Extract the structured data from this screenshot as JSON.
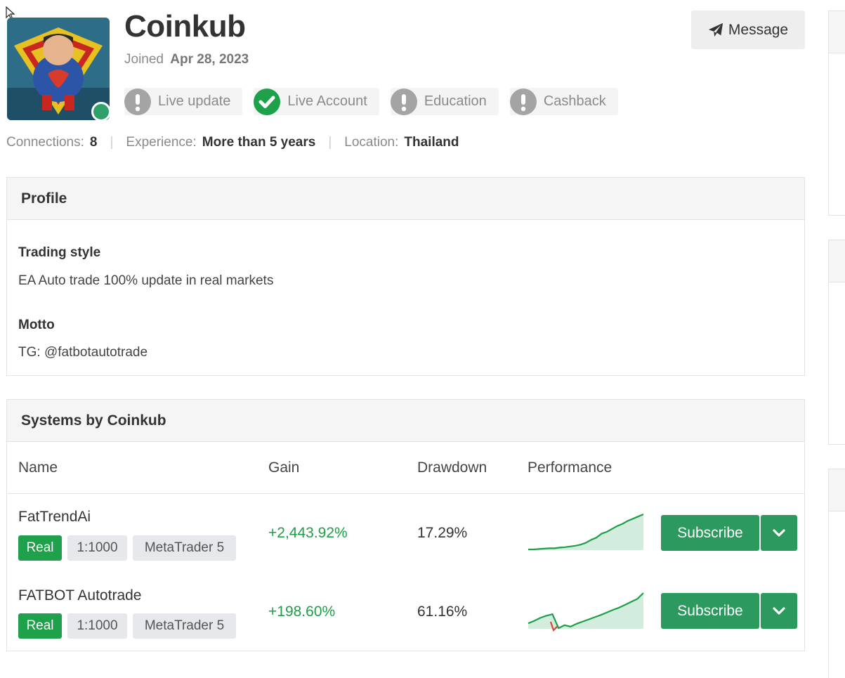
{
  "profile_header": {
    "name": "Coinkub",
    "joined_label": "Joined",
    "joined_date": "Apr 28, 2023",
    "message_label": "Message",
    "online_color": "#2ea06a"
  },
  "badges": [
    {
      "label": "Live update",
      "status": "warning",
      "icon": "exclamation-icon"
    },
    {
      "label": "Live Account",
      "status": "verified",
      "icon": "check-icon"
    },
    {
      "label": "Education",
      "status": "warning",
      "icon": "exclamation-icon"
    },
    {
      "label": "Cashback",
      "status": "warning",
      "icon": "exclamation-icon"
    }
  ],
  "stats": {
    "connections_label": "Connections:",
    "connections_value": "8",
    "experience_label": "Experience:",
    "experience_value": "More than 5 years",
    "location_label": "Location:",
    "location_value": "Thailand"
  },
  "profile_panel": {
    "title": "Profile",
    "trading_style_label": "Trading style",
    "trading_style_value": "EA Auto trade 100% update in real markets",
    "motto_label": "Motto",
    "motto_value": "TG: @fatbotautotrade"
  },
  "systems_panel": {
    "title": "Systems by Coinkub",
    "columns": [
      "Name",
      "Gain",
      "Drawdown",
      "Performance"
    ],
    "rows": [
      {
        "name": "FatTrendAi",
        "tags": [
          "Real",
          "1:1000",
          "MetaTrader 5"
        ],
        "gain": "+2,443.92%",
        "drawdown": "17.29%",
        "subscribe_label": "Subscribe",
        "performance_trend": [
          0.02,
          0.02,
          0.03,
          0.04,
          0.05,
          0.05,
          0.07,
          0.08,
          0.1,
          0.12,
          0.15,
          0.2,
          0.28,
          0.34,
          0.45,
          0.5,
          0.58,
          0.66,
          0.72,
          0.8,
          0.86,
          0.92,
          0.98
        ]
      },
      {
        "name": "FATBOT Autotrade",
        "tags": [
          "Real",
          "1:1000",
          "MetaTrader 5"
        ],
        "gain": "+198.60%",
        "drawdown": "61.16%",
        "subscribe_label": "Subscribe",
        "performance_trend": [
          0.15,
          0.22,
          0.3,
          0.36,
          0.4,
          0.02,
          0.1,
          0.06,
          0.14,
          0.2,
          0.26,
          0.32,
          0.38,
          0.45,
          0.52,
          0.58,
          0.66,
          0.74,
          0.82,
          0.98
        ]
      }
    ]
  },
  "colors": {
    "positive_gain": "#1f9e48",
    "subscribe_button": "#2c9a5e",
    "real_tag": "#1fa14b",
    "verified_badge": "#1fa14b",
    "warning_badge": "#a4a4a4"
  }
}
